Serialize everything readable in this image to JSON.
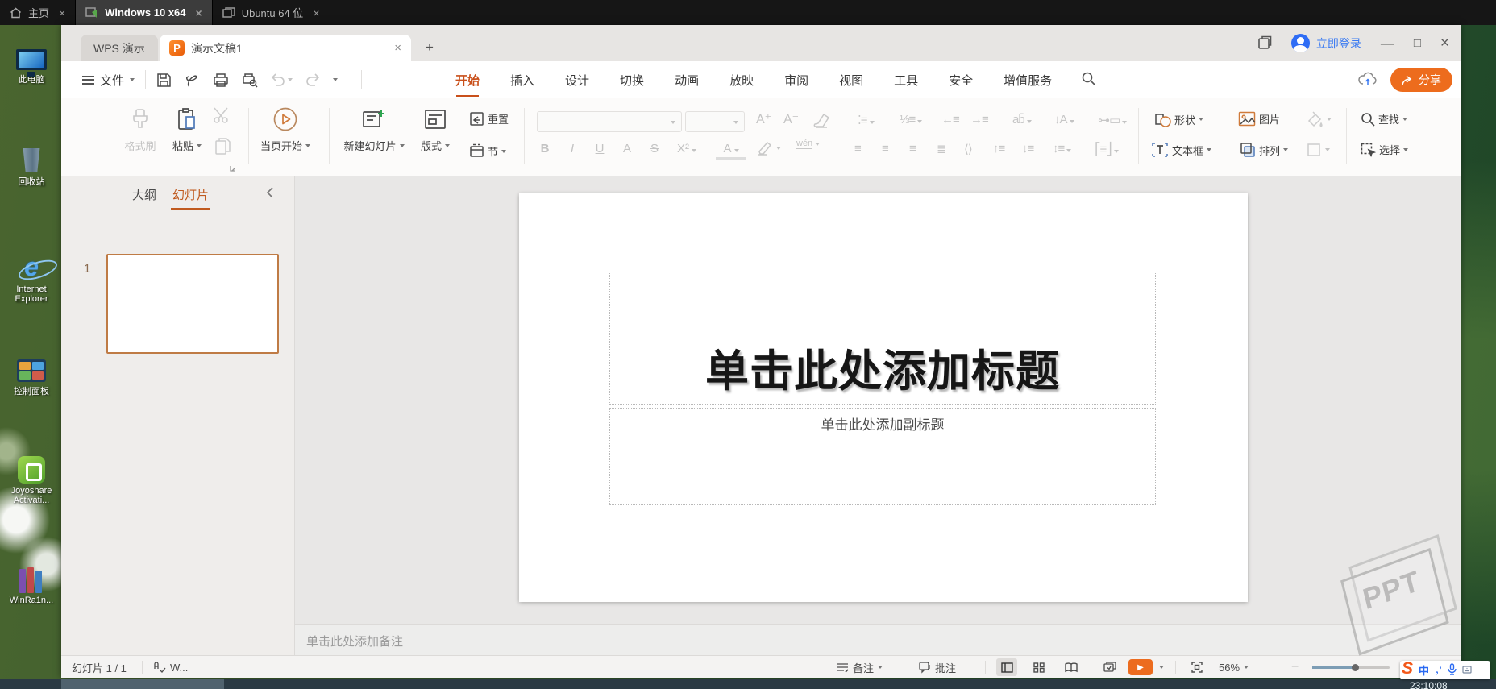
{
  "vm": {
    "tabs": [
      {
        "label": "主页"
      },
      {
        "label": "Windows 10 x64"
      },
      {
        "label": "Ubuntu 64 位"
      }
    ]
  },
  "desktop": {
    "icons": [
      {
        "label": "此电脑"
      },
      {
        "label": "回收站"
      },
      {
        "label": "Internet Explorer"
      },
      {
        "label": "控制面板"
      },
      {
        "label": "Joyoshare Activati..."
      },
      {
        "label": "WinRa1n..."
      }
    ]
  },
  "titlebar": {
    "home_tab": "WPS 演示",
    "doc_tab": "演示文稿1",
    "login": "立即登录"
  },
  "menubar": {
    "file": "文件",
    "tabs": [
      "开始",
      "插入",
      "设计",
      "切换",
      "动画",
      "放映",
      "审阅",
      "视图",
      "工具",
      "安全",
      "增值服务"
    ],
    "share": "分享"
  },
  "ribbon": {
    "format_painter": "格式刷",
    "paste": "粘贴",
    "play_from_page": "当页开始",
    "new_slide": "新建幻灯片",
    "layout": "版式",
    "reset": "重置",
    "section": "节",
    "bold": "B",
    "italic": "I",
    "underline": "U",
    "char_border": "A",
    "strike": "S",
    "superscript": "X²",
    "font_color": "A",
    "phonetic": "wén",
    "shapes": "形状",
    "picture": "图片",
    "textbox": "文本框",
    "arrange": "排列",
    "find": "查找",
    "select": "选择"
  },
  "sidebar": {
    "outline_tab": "大纲",
    "slides_tab": "幻灯片",
    "slide_number": "1"
  },
  "slide": {
    "title": "单击此处添加标题",
    "subtitle": "单击此处添加副标题"
  },
  "notes": {
    "placeholder": "单击此处添加备注"
  },
  "statusbar": {
    "slide_counter": "幻灯片 1 / 1",
    "spellcheck": "W...",
    "notes": "备注",
    "comments": "批注",
    "zoom": "56%"
  },
  "ime": {
    "lang": "中",
    "punct": "，’"
  },
  "taskbar": {
    "clock": "23:10:08"
  },
  "watermark": {
    "text": "PPT"
  },
  "colors": {
    "accent": "#c9501b",
    "share_button": "#ed6c1d",
    "login_blue": "#3a7af2"
  }
}
